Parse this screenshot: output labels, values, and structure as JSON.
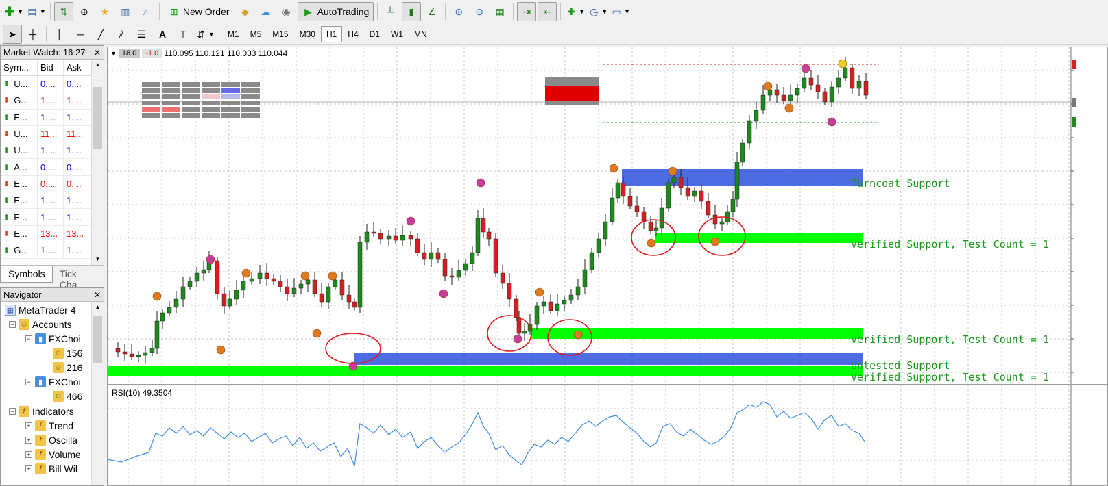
{
  "toolbar": {
    "new_order_label": "New Order",
    "autotrading_label": "AutoTrading",
    "timeframes": [
      "M1",
      "M5",
      "M15",
      "M30",
      "H1",
      "H4",
      "D1",
      "W1",
      "MN"
    ],
    "active_timeframe": "H1"
  },
  "market_watch": {
    "title": "Market Watch: 16:27",
    "columns": [
      "Sym...",
      "Bid",
      "Ask"
    ],
    "rows": [
      {
        "symbol": "U...",
        "bid": "0....",
        "ask": "0....",
        "dir": "up"
      },
      {
        "symbol": "G...",
        "bid": "1....",
        "ask": "1....",
        "dir": "down"
      },
      {
        "symbol": "E...",
        "bid": "1....",
        "ask": "1....",
        "dir": "up"
      },
      {
        "symbol": "U...",
        "bid": "11...",
        "ask": "11...",
        "dir": "down"
      },
      {
        "symbol": "U...",
        "bid": "1....",
        "ask": "1....",
        "dir": "up"
      },
      {
        "symbol": "A...",
        "bid": "0....",
        "ask": "0....",
        "dir": "up"
      },
      {
        "symbol": "E...",
        "bid": "0....",
        "ask": "0....",
        "dir": "down"
      },
      {
        "symbol": "E...",
        "bid": "1....",
        "ask": "1....",
        "dir": "up"
      },
      {
        "symbol": "E...",
        "bid": "1....",
        "ask": "1....",
        "dir": "up"
      },
      {
        "symbol": "E...",
        "bid": "13...",
        "ask": "13...",
        "dir": "down"
      },
      {
        "symbol": "G...",
        "bid": "1....",
        "ask": "1....",
        "dir": "up"
      }
    ],
    "tabs": [
      "Symbols",
      "Tick Cha"
    ]
  },
  "navigator": {
    "title": "Navigator",
    "root": "MetaTrader 4",
    "accounts_label": "Accounts",
    "broker1": "FXChoi",
    "acc1": "156",
    "acc2": "216",
    "broker2": "FXChoi",
    "acc3": "466",
    "indicators_label": "Indicators",
    "trend": "Trend",
    "oscillators": "Oscilla",
    "volumes": "Volume",
    "bill_williams": "Bill Wil"
  },
  "chart": {
    "tag1": "18.0",
    "tag2": "-1.0",
    "ohlc": "110.095 110.121 110.033 110.044",
    "zone_labels": [
      "Turncoat Support",
      "Verified Support, Test Count = 1",
      "Verified Support, Test Count = 1",
      "Untested Support",
      "Verified Support, Test Count = 1"
    ],
    "rsi_label": "RSI(10) 49.3504",
    "colors": {
      "bull": "#1e8a1e",
      "bear": "#d42020",
      "verified_zone": "#00ff00",
      "turncoat_zone": "#3a5ce0",
      "rsi_line": "#3a8ee8"
    }
  }
}
